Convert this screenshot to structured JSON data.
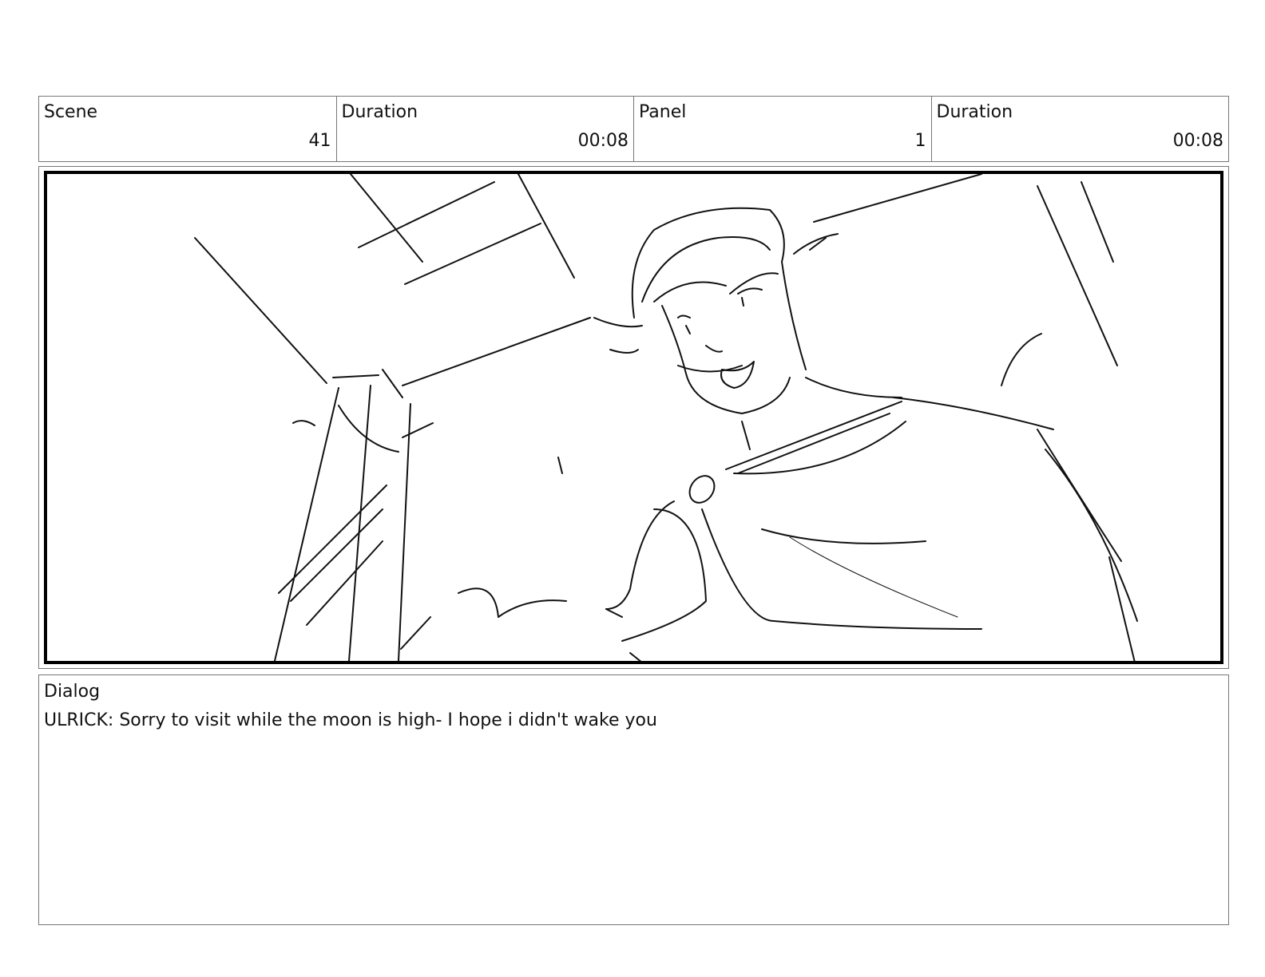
{
  "header": {
    "scene_label": "Scene",
    "scene_value": "41",
    "scene_duration_label": "Duration",
    "scene_duration_value": "00:08",
    "panel_label": "Panel",
    "panel_value": "1",
    "panel_duration_label": "Duration",
    "panel_duration_value": "00:08"
  },
  "panel": {
    "image_icon": "sketch-drawing"
  },
  "dialog": {
    "label": "Dialog",
    "text": "ULRICK: Sorry to visit while the moon is high- I hope i didn't wake you"
  }
}
